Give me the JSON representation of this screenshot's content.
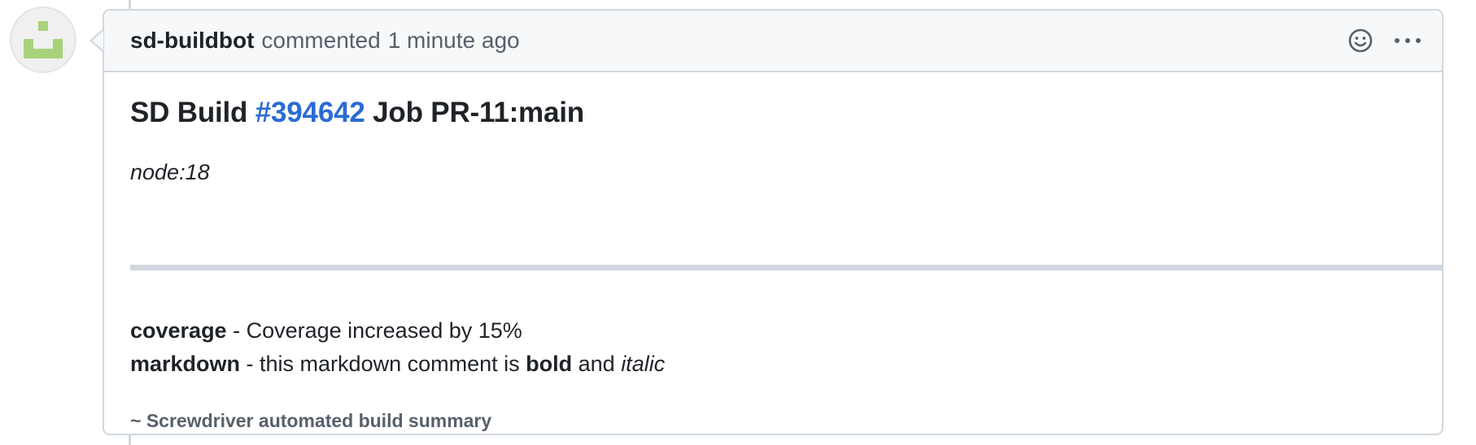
{
  "comment": {
    "author": "sd-buildbot",
    "action": "commented",
    "timestamp": "1 minute ago",
    "build": {
      "prefix": "SD Build",
      "number": "#394642",
      "job": "Job PR-11:main"
    },
    "node": "node:18",
    "statuses": [
      {
        "name": "coverage",
        "separator": " - ",
        "message": "Coverage increased by 15%"
      },
      {
        "name": "markdown",
        "separator": " - ",
        "message_pre": "this markdown comment is ",
        "bold": "bold",
        "mid": " and ",
        "italic": "italic"
      }
    ],
    "footer": "~ Screwdriver automated build summary"
  },
  "icons": {
    "avatar": "identicon-avatar",
    "reaction": "smiley-icon",
    "more": "kebab-horizontal-icon"
  },
  "colors": {
    "link": "#2a6bd4",
    "header_bg": "#f6f8fa",
    "border": "#d0d7de",
    "avatar_green": "#a8d27a"
  }
}
